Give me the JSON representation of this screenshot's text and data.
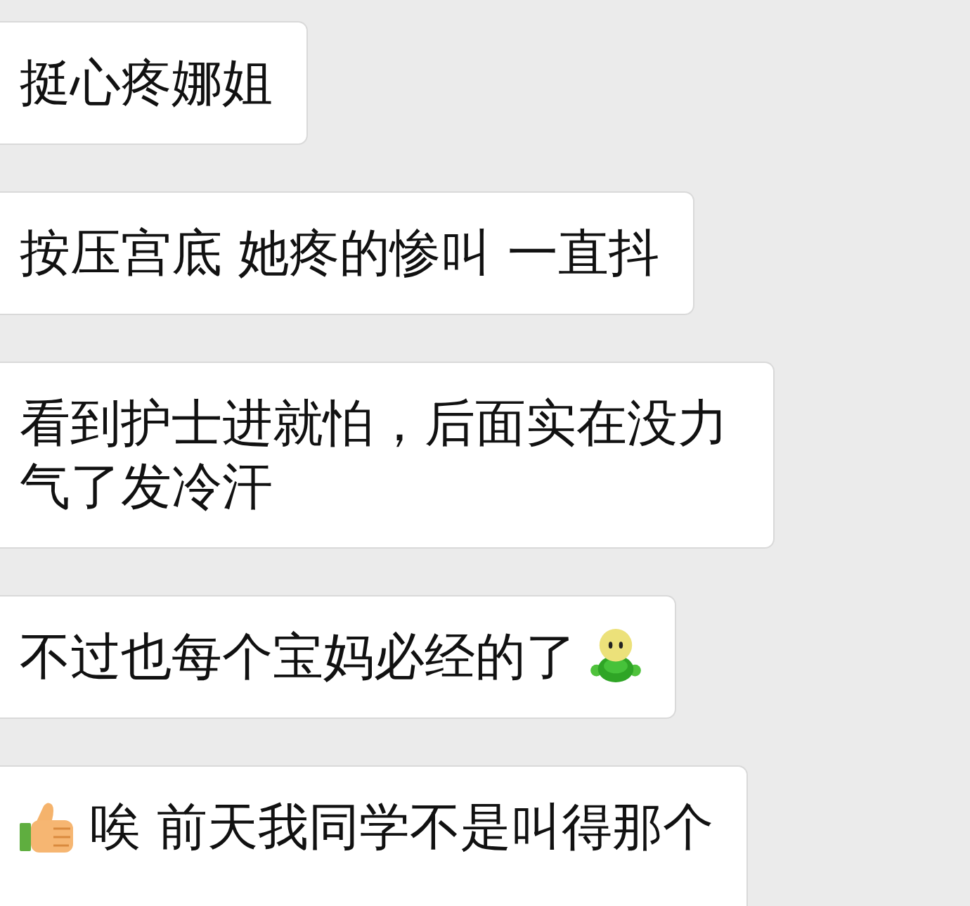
{
  "messages": [
    {
      "parts": [
        {
          "kind": "text",
          "text": "挺心疼娜姐"
        }
      ]
    },
    {
      "parts": [
        {
          "kind": "text",
          "text": "按压宫底 她疼的惨叫 一直抖"
        }
      ]
    },
    {
      "parts": [
        {
          "kind": "text",
          "text": "看到护士进就怕，后面实在没力气了发冷汗"
        }
      ]
    },
    {
      "parts": [
        {
          "kind": "text",
          "text": "不过也每个宝妈必经的了"
        },
        {
          "kind": "figure"
        }
      ]
    },
    {
      "parts": [
        {
          "kind": "thumbsup"
        },
        {
          "kind": "text",
          "text": "唉 前天我同学不是叫得那个"
        }
      ]
    }
  ]
}
